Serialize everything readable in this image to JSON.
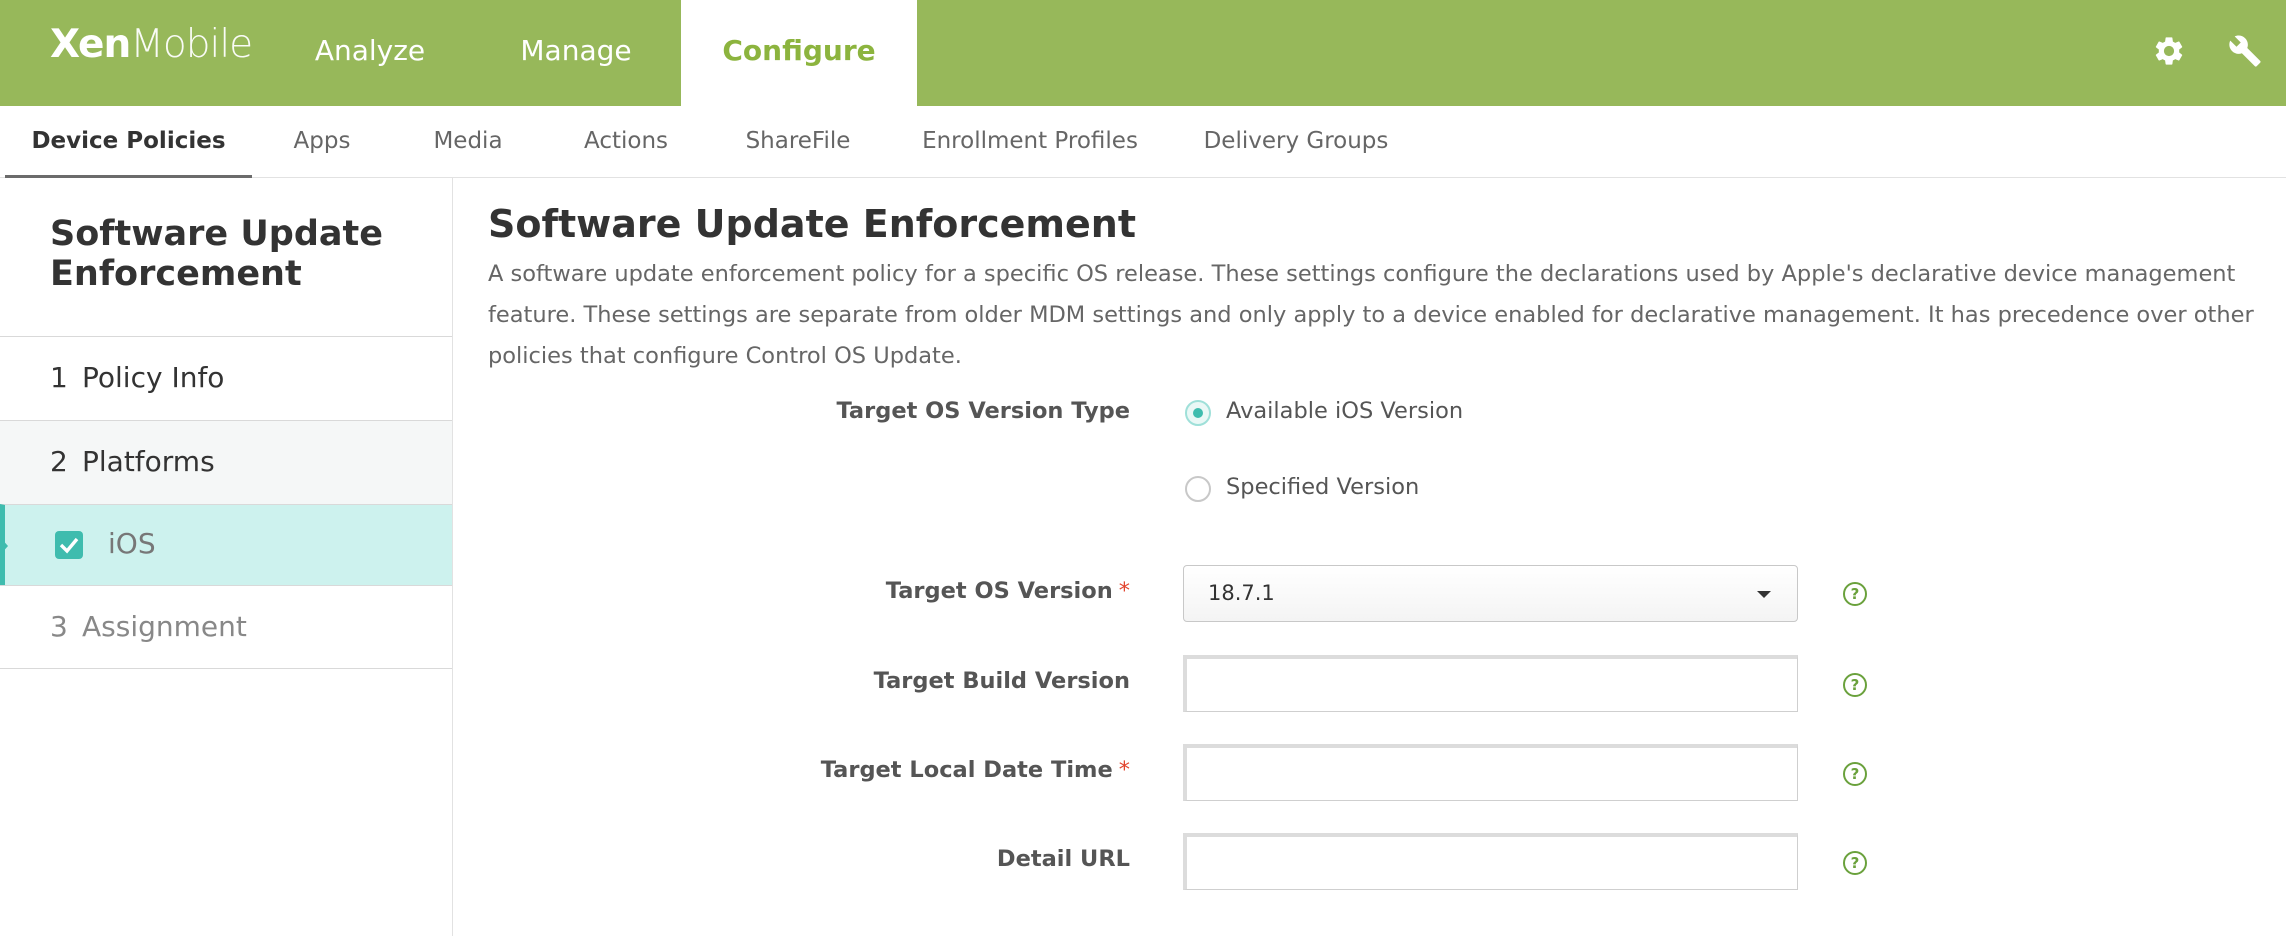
{
  "app": {
    "logo_part1": "Xen",
    "logo_part2": "Mobile"
  },
  "topnav": {
    "tabs": [
      {
        "label": "Analyze"
      },
      {
        "label": "Manage"
      },
      {
        "label": "Configure",
        "active": true
      }
    ],
    "icons": [
      "gear-icon",
      "wrench-icon"
    ]
  },
  "subnav": {
    "tabs": [
      {
        "label": "Device Policies",
        "active": true
      },
      {
        "label": "Apps"
      },
      {
        "label": "Media"
      },
      {
        "label": "Actions"
      },
      {
        "label": "ShareFile"
      },
      {
        "label": "Enrollment Profiles"
      },
      {
        "label": "Delivery Groups"
      }
    ]
  },
  "sidebar": {
    "title": "Software Update Enforcement",
    "steps": [
      {
        "num": "1",
        "label": "Policy Info"
      },
      {
        "num": "2",
        "label": "Platforms"
      },
      {
        "label": "iOS",
        "checked": true,
        "selected": true
      },
      {
        "num": "3",
        "label": "Assignment"
      }
    ]
  },
  "main": {
    "title": "Software Update Enforcement",
    "description": "A software update enforcement policy for a specific OS release. These settings configure the declarations used by Apple's declarative device management feature. These settings are separate from older MDM settings and only apply to a device enabled for declarative management. It has precedence over other policies that configure Control OS Update.",
    "target_os_version_type": {
      "label": "Target OS Version Type",
      "options": [
        {
          "label": "Available iOS Version",
          "selected": true
        },
        {
          "label": "Specified Version",
          "selected": false
        }
      ]
    },
    "target_os_version": {
      "label": "Target OS Version",
      "required": "*",
      "value": "18.7.1"
    },
    "target_build_version": {
      "label": "Target Build Version",
      "value": ""
    },
    "target_local_date_time": {
      "label": "Target Local Date Time",
      "required": "*",
      "value": ""
    },
    "detail_url": {
      "label": "Detail URL",
      "value": ""
    },
    "help_glyph": "?"
  },
  "colors": {
    "brand_green": "#97b85a",
    "active_tab_text": "#8cb43e",
    "accent_teal": "#3fbcae",
    "selected_row_bg": "#cdf2ee",
    "required_star": "#e2452f",
    "help_icon": "#6aa13c"
  }
}
